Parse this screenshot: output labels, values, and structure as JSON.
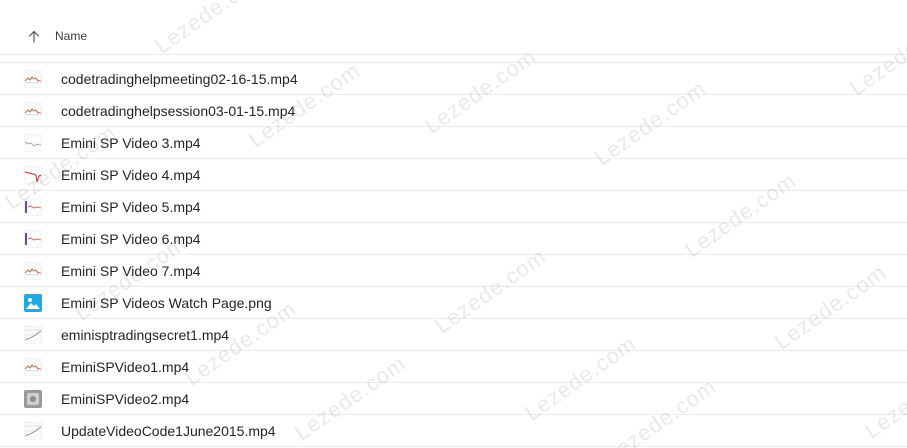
{
  "header": {
    "sort_icon": "arrow-up-icon",
    "name_label": "Name"
  },
  "files": [
    {
      "name": "codetradinghelpmeeting02-16-15.mp4",
      "icon": "video-thumbnail-icon",
      "thumb": "chart-red"
    },
    {
      "name": "codetradinghelpsession03-01-15.mp4",
      "icon": "video-thumbnail-icon",
      "thumb": "chart-red"
    },
    {
      "name": "Emini SP Video 3.mp4",
      "icon": "video-thumbnail-icon",
      "thumb": "chart-gray"
    },
    {
      "name": "Emini SP Video 4.mp4",
      "icon": "video-thumbnail-icon",
      "thumb": "chart-red-spike"
    },
    {
      "name": "Emini SP Video 5.mp4",
      "icon": "video-thumbnail-icon",
      "thumb": "chart-purple"
    },
    {
      "name": "Emini SP Video 6.mp4",
      "icon": "video-thumbnail-icon",
      "thumb": "chart-purple"
    },
    {
      "name": "Emini SP Video 7.mp4",
      "icon": "video-thumbnail-icon",
      "thumb": "chart-red"
    },
    {
      "name": "Emini SP Videos Watch Page.png",
      "icon": "image-file-icon",
      "thumb": "image-blue"
    },
    {
      "name": "eminisptradingsecret1.mp4",
      "icon": "video-thumbnail-icon",
      "thumb": "chart-lines"
    },
    {
      "name": "EminiSPVideo1.mp4",
      "icon": "video-thumbnail-icon",
      "thumb": "chart-red"
    },
    {
      "name": "EminiSPVideo2.mp4",
      "icon": "video-thumbnail-icon",
      "thumb": "box-gray"
    },
    {
      "name": "UpdateVideoCode1June2015.mp4",
      "icon": "video-thumbnail-icon",
      "thumb": "chart-lines"
    }
  ],
  "watermark": {
    "text": "Lezede.com"
  },
  "colors": {
    "divider": "#edebe9",
    "text": "#242424",
    "image_icon": "#1fa9e5"
  }
}
